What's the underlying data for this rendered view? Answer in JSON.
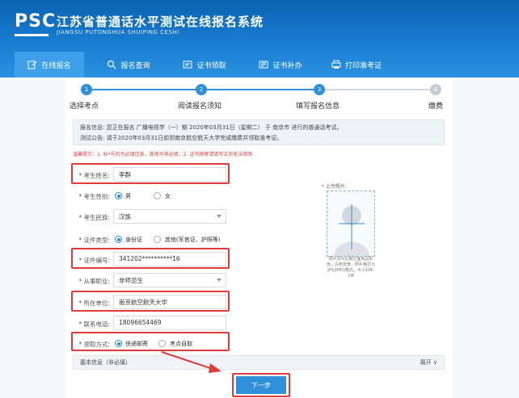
{
  "header": {
    "logo": "PSC",
    "title": "江苏省普通话水平测试在线报名系统",
    "subtitle": "JIANGSU PUTONGHUA SHUIPING CESHI"
  },
  "nav": [
    {
      "label": "在线报名",
      "icon": "edit-icon"
    },
    {
      "label": "报名查询",
      "icon": "search-icon"
    },
    {
      "label": "证书领取",
      "icon": "certificate-icon"
    },
    {
      "label": "证书补办",
      "icon": "reissue-icon"
    },
    {
      "label": "打印准考证",
      "icon": "printer-icon"
    }
  ],
  "steps": [
    {
      "num": "1",
      "label": "选择考点"
    },
    {
      "num": "2",
      "label": "阅读报名须知"
    },
    {
      "num": "3",
      "label": "填写报名信息"
    },
    {
      "num": "4",
      "label": "缴费"
    }
  ],
  "info": {
    "line1": "报名信息: 您正在报名 广播电视学（一）期 2020年03月31日（星期二） 于 南京市 进行的普通话考试。",
    "line2": "测试公告: 请于2020年03月31日前到南京航空航天大学完成缴费并领取准考证。"
  },
  "notice": "温馨提示：1. 标*号的为必填信息，其他为非必填；2. 证书邮寄请填写文员无法修改",
  "form": {
    "name": {
      "label": "* 考生姓名:",
      "value": "李群"
    },
    "gender": {
      "label": "* 考生性别:",
      "options": [
        "男",
        "女"
      ]
    },
    "ethnicity": {
      "label": "* 考生民族:",
      "value": "汉族"
    },
    "id_type": {
      "label": "* 证件类型:",
      "options": [
        "身份证",
        "其他(军官证、护照等)"
      ]
    },
    "id_number": {
      "label": "* 证件编号:",
      "value": "341202**********16"
    },
    "occupation": {
      "label": "* 从事职业:",
      "value": "非师范生"
    },
    "unit": {
      "label": "* 所在单位:",
      "value": "南京航空航天大学"
    },
    "phone": {
      "label": "* 联系电话:",
      "value": "18096654469"
    },
    "pickup": {
      "label": "* 领取方式:",
      "options": [
        "快递邮寄",
        "考点自取"
      ]
    }
  },
  "photo": {
    "label": "* 上传照片:",
    "tip": "照片须为近期正面免冠彩色，白色背景，照片格式为JPG/JPEG格式，大小10K-1M"
  },
  "basic": {
    "label": "基本信息（非必填）",
    "expand": "展开 ∨"
  },
  "next_button": "下一步"
}
